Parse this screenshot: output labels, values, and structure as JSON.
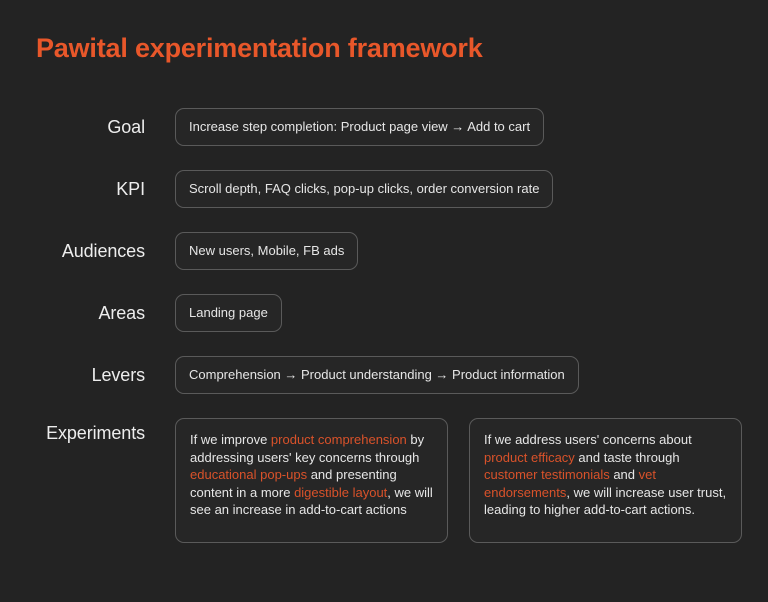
{
  "title": "Pawital experimentation framework",
  "colors": {
    "background": "#232323",
    "accent": "#E8572A",
    "accent_text": "#D9522A",
    "text": "#EDEDED",
    "border": "#5A5A5A",
    "field_background": "#262626"
  },
  "rows": [
    {
      "label": "Goal",
      "fields": [
        "Increase step completion: Product page view → Add to cart"
      ]
    },
    {
      "label": "KPI",
      "fields": [
        "Scroll depth, FAQ clicks, pop-up clicks, order conversion rate"
      ]
    },
    {
      "label": "Audiences",
      "fields": [
        "New users, Mobile, FB ads"
      ]
    },
    {
      "label": "Areas",
      "fields": [
        "Landing page"
      ]
    },
    {
      "label": "Levers",
      "fields": [
        "Comprehension → Product understanding → Product information"
      ]
    }
  ],
  "experiments": {
    "label": "Experiments",
    "cards": [
      {
        "segments": [
          {
            "text": "If we improve ",
            "highlight": false
          },
          {
            "text": "product comprehension",
            "highlight": true
          },
          {
            "text": " by addressing users' key concerns through ",
            "highlight": false
          },
          {
            "text": "educational pop-ups",
            "highlight": true
          },
          {
            "text": " and presenting content in a more ",
            "highlight": false
          },
          {
            "text": "digestible layout",
            "highlight": true
          },
          {
            "text": ", we will see an increase in add-to-cart actions",
            "highlight": false
          }
        ]
      },
      {
        "segments": [
          {
            "text": "If we address users' concerns about ",
            "highlight": false
          },
          {
            "text": "product efficacy",
            "highlight": true
          },
          {
            "text": " and taste through ",
            "highlight": false
          },
          {
            "text": "customer testimonials",
            "highlight": true
          },
          {
            "text": " and ",
            "highlight": false
          },
          {
            "text": "vet endorsements",
            "highlight": true
          },
          {
            "text": ", we will increase user trust, leading to higher add-to-cart actions.",
            "highlight": false
          }
        ]
      }
    ]
  }
}
